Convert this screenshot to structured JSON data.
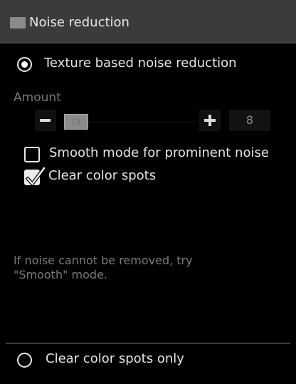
{
  "panel": {
    "title": "Noise reduction"
  },
  "texture_option": {
    "label": "Texture based noise reduction",
    "selected": true
  },
  "amount": {
    "label": "Amount",
    "value": "8",
    "minus_symbol": "-",
    "plus_symbol": "+"
  },
  "options": {
    "smooth_mode": {
      "label": "Smooth mode for prominent noise",
      "checked": false
    },
    "clear_color_spots": {
      "label": "Clear color spots",
      "checked": true
    }
  },
  "hint": {
    "text": "If noise cannot be removed, try\n\"Smooth\" mode."
  },
  "spots_only_option": {
    "label": "Clear color spots only",
    "selected": false
  },
  "colors": {
    "background": "#000000",
    "title_bar": "#3b3b3b",
    "text": "#e6e6e6",
    "muted_text": "#7a7a7a",
    "slider_thumb": "#8c8c8c"
  },
  "icons": {
    "title": "panel-swatch-icon",
    "minus": "minus-icon",
    "plus": "plus-icon",
    "check": "checkmark-icon"
  }
}
